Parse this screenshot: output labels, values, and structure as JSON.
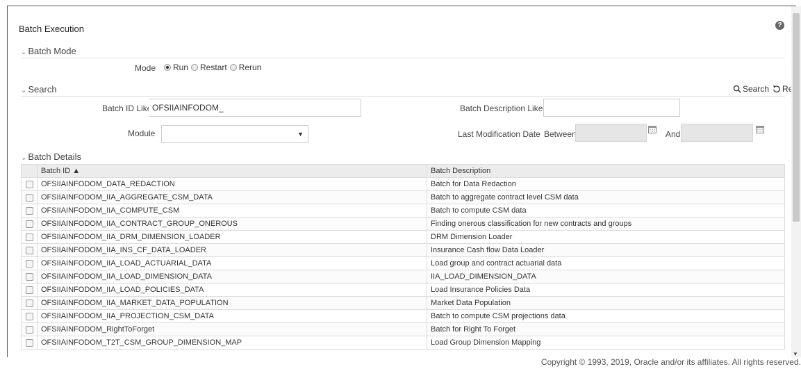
{
  "page": {
    "title": "Batch Execution",
    "help": "?"
  },
  "batch_mode": {
    "header": "Batch Mode",
    "mode_label": "Mode",
    "options": [
      "Run",
      "Restart",
      "Rerun"
    ],
    "selected": "Run"
  },
  "search": {
    "header": "Search",
    "search_label": "Search",
    "reset_label": "Reset",
    "batch_id_label": "Batch ID Like",
    "batch_id_value": "OFSIIAINFODOM_",
    "batch_desc_label": "Batch Description Like",
    "batch_desc_value": "",
    "module_label": "Module",
    "module_value": "",
    "last_mod_label": "Last Modification Date",
    "between_label": "Between",
    "and_label": "And"
  },
  "batch_details": {
    "header": "Batch Details",
    "columns": [
      "Batch ID ▲",
      "Batch Description"
    ],
    "rows": [
      [
        "OFSIIAINFODOM_DATA_REDACTION",
        "Batch for Data Redaction"
      ],
      [
        "OFSIIAINFODOM_IIA_AGGREGATE_CSM_DATA",
        "Batch to aggregate contract level CSM data"
      ],
      [
        "OFSIIAINFODOM_IIA_COMPUTE_CSM",
        "Batch to compute CSM data"
      ],
      [
        "OFSIIAINFODOM_IIA_CONTRACT_GROUP_ONEROUS",
        "Finding onerous classification for new contracts and groups"
      ],
      [
        "OFSIIAINFODOM_IIA_DRM_DIMENSION_LOADER",
        "DRM Dimension Loader"
      ],
      [
        "OFSIIAINFODOM_IIA_INS_CF_DATA_LOADER",
        "Insurance Cash flow Data Loader"
      ],
      [
        "OFSIIAINFODOM_IIA_LOAD_ACTUARIAL_DATA",
        "Load group and contract actuarial data"
      ],
      [
        "OFSIIAINFODOM_IIA_LOAD_DIMENSION_DATA",
        "IIA_LOAD_DIMENSION_DATA"
      ],
      [
        "OFSIIAINFODOM_IIA_LOAD_POLICIES_DATA",
        "Load Insurance Policies Data"
      ],
      [
        "OFSIIAINFODOM_IIA_MARKET_DATA_POPULATION",
        "Market Data Population"
      ],
      [
        "OFSIIAINFODOM_IIA_PROJECTION_CSM_DATA",
        "Batch to compute CSM projections data"
      ],
      [
        "OFSIIAINFODOM_RightToForget",
        "Batch for Right To Forget"
      ],
      [
        "OFSIIAINFODOM_T2T_CSM_GROUP_DIMENSION_MAP",
        "Load Group Dimension Mapping"
      ]
    ]
  },
  "footer": {
    "copyright": "Copyright © 1993, 2019, Oracle and/or its affiliates. All rights reserved."
  }
}
